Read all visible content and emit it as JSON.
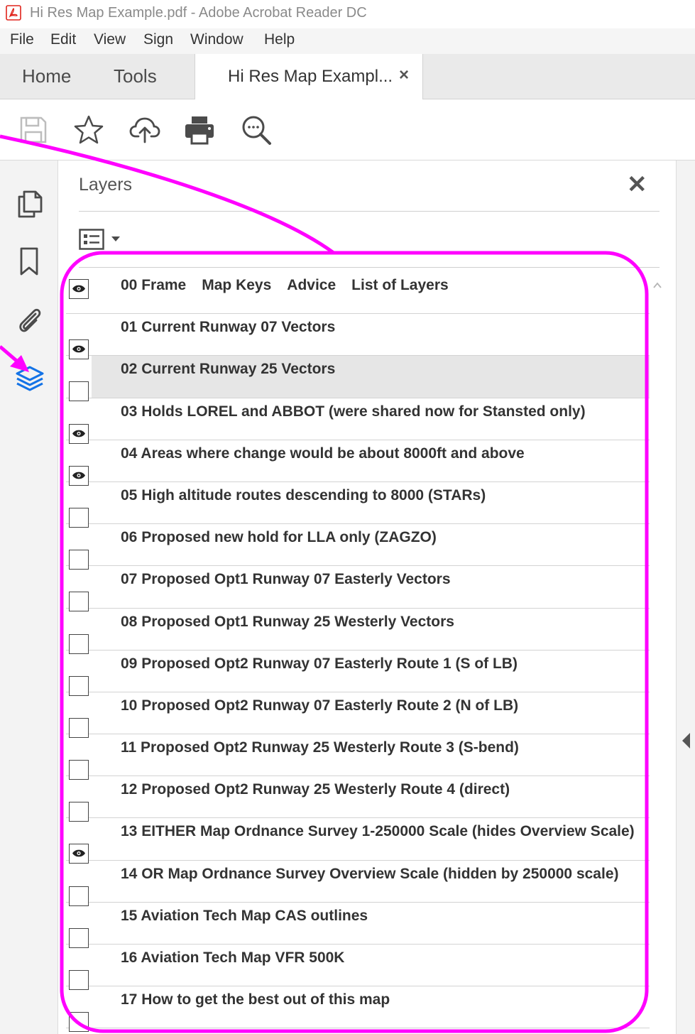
{
  "window": {
    "title": "Hi Res Map Example.pdf - Adobe Acrobat Reader DC",
    "app_icon": "acrobat-icon"
  },
  "menu": [
    "File",
    "Edit",
    "View",
    "Sign",
    "Window",
    "Help"
  ],
  "tabs": {
    "home": "Home",
    "tools": "Tools",
    "document": "Hi Res Map Exampl...",
    "close_glyph": "×"
  },
  "toolbar": {
    "icons": [
      "save-icon",
      "star-icon",
      "cloud-upload-icon",
      "print-icon",
      "zoom-search-icon"
    ]
  },
  "leftrail": {
    "icons": [
      "pages-icon",
      "bookmark-icon",
      "attachment-icon",
      "layers-icon"
    ],
    "active": "layers-icon",
    "active_color": "#1473e6"
  },
  "panel": {
    "title": "Layers",
    "close_glyph": "✕",
    "options_icon": "layer-options-icon"
  },
  "layers": [
    {
      "label_parts": [
        "00 Frame",
        "Map Keys",
        "Advice",
        "List of Layers"
      ],
      "visible": true
    },
    {
      "label": "01 Current Runway 07 Vectors",
      "visible": true
    },
    {
      "label": "02 Current Runway 25 Vectors",
      "visible": false,
      "selected": true
    },
    {
      "label": "03 Holds LOREL and ABBOT (were shared now for Stansted only)",
      "visible": true
    },
    {
      "label": "04 Areas where change would be about 8000ft and above",
      "visible": true
    },
    {
      "label": "05 High altitude routes descending to 8000 (STARs)",
      "visible": false
    },
    {
      "label": "06 Proposed new hold for LLA only (ZAGZO)",
      "visible": false
    },
    {
      "label": "07 Proposed Opt1 Runway 07 Easterly Vectors",
      "visible": false
    },
    {
      "label": "08 Proposed Opt1 Runway 25 Westerly Vectors",
      "visible": false
    },
    {
      "label": "09 Proposed Opt2 Runway 07 Easterly Route 1 (S of LB)",
      "visible": false
    },
    {
      "label": "10 Proposed Opt2 Runway 07 Easterly Route 2 (N of LB)",
      "visible": false
    },
    {
      "label": "11 Proposed Opt2 Runway 25 Westerly Route 3 (S-bend)",
      "visible": false
    },
    {
      "label": "12 Proposed Opt2 Runway 25 Westerly Route 4 (direct)",
      "visible": false
    },
    {
      "label": "13 EITHER Map Ordnance Survey 1-250000 Scale (hides Overview Scale)",
      "visible": true
    },
    {
      "label": "14 OR Map Ordnance Survey Overview Scale (hidden by 250000 scale)",
      "visible": false
    },
    {
      "label": "15 Aviation Tech Map CAS outlines",
      "visible": false
    },
    {
      "label": "16 Aviation Tech Map VFR 500K",
      "visible": false
    },
    {
      "label": "17 How to get the best out of this map",
      "visible": false
    }
  ],
  "annotation": {
    "highlight_color": "#ff00ff"
  }
}
